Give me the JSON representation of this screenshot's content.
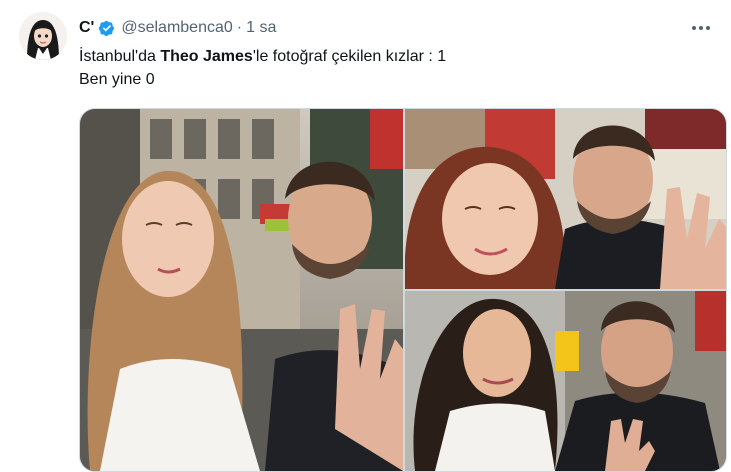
{
  "tweet": {
    "display_name": "C'",
    "handle": "@selambenca0",
    "separator": "·",
    "time": "1 sa",
    "text": {
      "part1": "İstanbul'da ",
      "bold": "Theo James",
      "part2": "'le fotoğraf çekilen kızlar : 1",
      "line2": "Ben yine 0"
    },
    "verified_icon": "verified-badge-icon",
    "more_icon": "more-horizontal-icon"
  },
  "colors": {
    "text": "#0f1419",
    "secondary": "#536471",
    "verified": "#1d9bf0",
    "border": "#cfd9de"
  },
  "media": {
    "photo_count": 3
  }
}
